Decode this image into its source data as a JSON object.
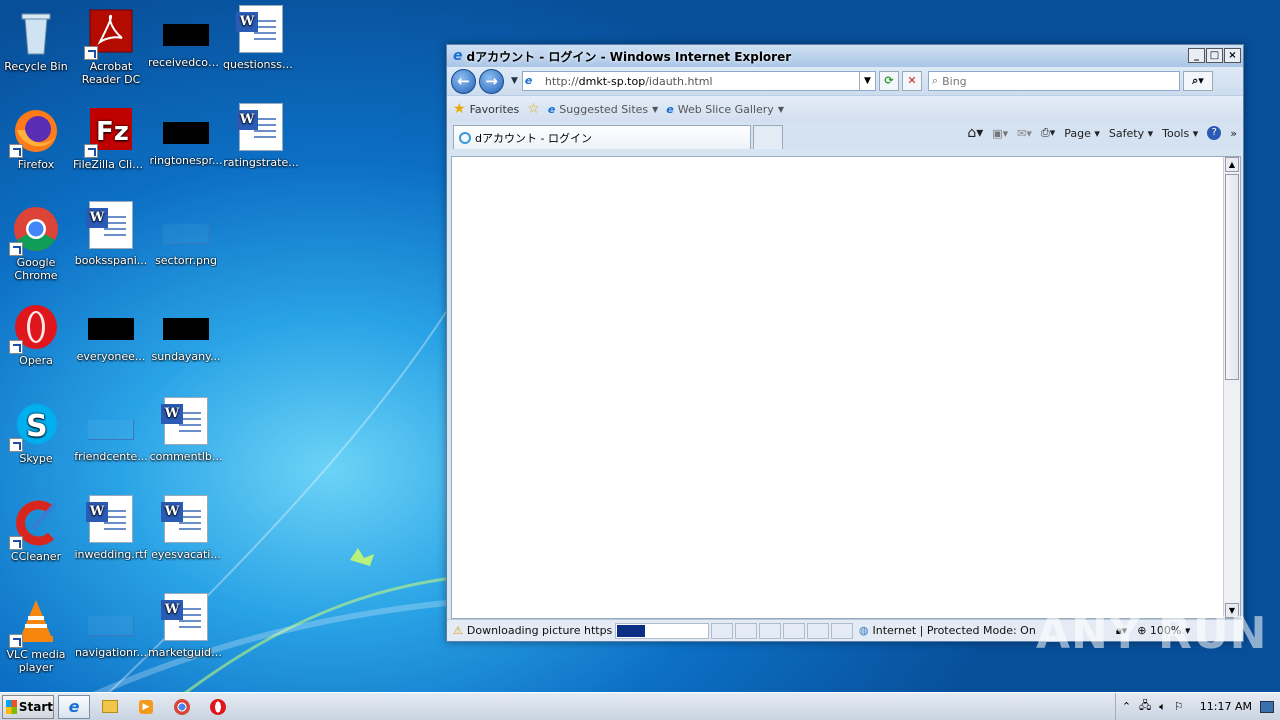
{
  "desktop": {
    "icons": [
      {
        "label": "Recycle Bin",
        "icon": "recycle-bin-icon"
      },
      {
        "label": "Acrobat Reader DC",
        "icon": "acrobat-icon"
      },
      {
        "label": "receivedcou...",
        "icon": "file-icon"
      },
      {
        "label": "questionssa...",
        "icon": "word-doc-icon"
      },
      {
        "label": "Firefox",
        "icon": "firefox-icon"
      },
      {
        "label": "FileZilla Client",
        "icon": "filezilla-icon"
      },
      {
        "label": "ringtonespr...",
        "icon": "file-icon"
      },
      {
        "label": "ratingstrate...",
        "icon": "word-doc-icon"
      },
      {
        "label": "Google Chrome",
        "icon": "chrome-icon"
      },
      {
        "label": "booksspani...",
        "icon": "word-doc-icon"
      },
      {
        "label": "sectorr.png",
        "icon": "image-file-icon"
      },
      {
        "label": "Opera",
        "icon": "opera-icon"
      },
      {
        "label": "everyonee...",
        "icon": "file-icon"
      },
      {
        "label": "sundayany...",
        "icon": "file-icon"
      },
      {
        "label": "Skype",
        "icon": "skype-icon"
      },
      {
        "label": "friendcente...",
        "icon": "image-file-icon"
      },
      {
        "label": "commentlb...",
        "icon": "word-doc-icon"
      },
      {
        "label": "CCleaner",
        "icon": "ccleaner-icon"
      },
      {
        "label": "inwedding.rtf",
        "icon": "word-doc-icon"
      },
      {
        "label": "eyesvacati...",
        "icon": "word-doc-icon"
      },
      {
        "label": "VLC media player",
        "icon": "vlc-icon"
      },
      {
        "label": "navigationr...",
        "icon": "image-file-icon"
      },
      {
        "label": "marketguide...",
        "icon": "word-doc-icon"
      }
    ]
  },
  "ie": {
    "title": "dアカウント - ログイン - Windows Internet Explorer",
    "address_prefix": "http://",
    "address_host": "dmkt-sp.top",
    "address_path": "/idauth.html",
    "search_placeholder": "Bing",
    "favorites_label": "Favorites",
    "suggested_sites_label": "Suggested Sites",
    "web_slice_label": "Web Slice Gallery",
    "tab_title": "dアカウント - ログイン",
    "cmd_page": "Page",
    "cmd_safety": "Safety",
    "cmd_tools": "Tools",
    "status_text": "Downloading picture https://ic",
    "status_zone": "Internet | Protected Mode: On",
    "zoom": "100%"
  },
  "taskbar": {
    "start_label": "Start",
    "clock": "11:17 AM"
  },
  "watermark": "ANY RUN"
}
